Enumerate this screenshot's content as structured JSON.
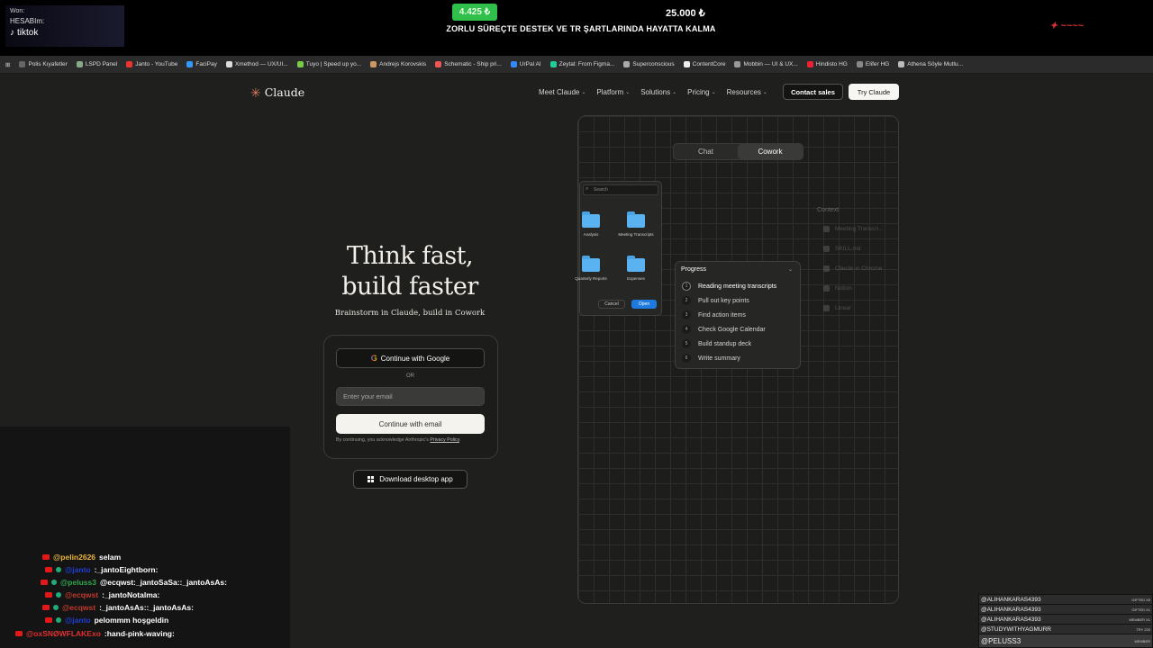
{
  "overlay": {
    "tiktok_line1": "Won:",
    "tiktok_line2": "HESABIm:",
    "tiktok_brand": "tiktok",
    "goal_current": "4.425 ₺",
    "goal_target": "25.000 ₺",
    "goal_title": "ZORLU SÜREÇTE DESTEK VE TR ŞARTLARINDA HAYATTA KALMA"
  },
  "bookmarks": [
    "Polis Kıyafetler",
    "LSPD Panel",
    "Janto - YouTube",
    "FaciPay",
    "Xmethod — UX/UI...",
    "Tuyo | Speed up yo...",
    "Andrejs Korovskis",
    "Schematic - Ship pri...",
    "UrPal AI",
    "Zeytal: From Figma...",
    "Superconscious",
    "ContentCore",
    "Mobbin — UI & UX...",
    "Hindisto HG",
    "Elifer HG",
    "Athena Söyle Mutlu..."
  ],
  "header": {
    "logo": "Claude",
    "nav": [
      "Meet Claude",
      "Platform",
      "Solutions",
      "Pricing",
      "Resources"
    ],
    "contact_sales": "Contact sales",
    "try_claude": "Try Claude"
  },
  "hero": {
    "title_line1": "Think fast,",
    "title_line2": "build faster",
    "subtitle": "Brainstorm in Claude, build in Cowork"
  },
  "signup": {
    "google_button": "Continue with Google",
    "or": "OR",
    "email_placeholder": "Enter your email",
    "continue_email": "Continue with email",
    "terms_prefix": "By continuing, you acknowledge Anthropic's",
    "privacy_link": "Privacy Policy",
    "download": "Download desktop app"
  },
  "demo": {
    "tab_chat": "Chat",
    "tab_cowork": "Cowork",
    "search_placeholder": "Search",
    "folders": [
      "Analysis",
      "Meeting Transcripts",
      "Quarterly Reports",
      "Expenses"
    ],
    "cancel": "Cancel",
    "open": "Open",
    "context_title": "Context",
    "context_items": [
      "Meeting Transcri...",
      "SKILL.md",
      "Claude in Chrome",
      "Notion",
      "Linear"
    ],
    "progress_title": "Progress",
    "steps": [
      {
        "num": "1",
        "label": "Reading meeting transcripts"
      },
      {
        "num": "2",
        "label": "Pull out key points"
      },
      {
        "num": "3",
        "label": "Find action items"
      },
      {
        "num": "4",
        "label": "Check Google Calendar"
      },
      {
        "num": "5",
        "label": "Build standup deck"
      },
      {
        "num": "6",
        "label": "Write summary"
      }
    ]
  },
  "chat": [
    {
      "user": "@pelin2626",
      "color": "#e8b53a",
      "message": "selam"
    },
    {
      "user": "@janto",
      "color": "#1f3fd6",
      "message": ":_jantoEightborn:"
    },
    {
      "user": "@peluss3",
      "color": "#2fa84f",
      "message": "@ecqwst:_jantoSaSa::_jantoAsAs:"
    },
    {
      "user": "@ecqwst",
      "color": "#c0392b",
      "message": ":_jantoNotalma:"
    },
    {
      "user": "@ecqwst",
      "color": "#c0392b",
      "message": ":_jantoAsAs::_jantoAsAs:"
    },
    {
      "user": "@janto",
      "color": "#1f3fd6",
      "message": "pelommm hoşgeldin"
    },
    {
      "user": "@oxSNØWFLAKExo",
      "color": "#e03030",
      "message": ":hand-pink-waving:"
    }
  ],
  "gifts": [
    {
      "name": "@ALIHANKARAS4393",
      "tag": "GIFTED X5"
    },
    {
      "name": "@ALIHANKARAS4393",
      "tag": "GIFTED X1"
    },
    {
      "name": "@ALIHANKARAS4393",
      "tag": "MEMBER X1"
    },
    {
      "name": "@STUDYWITHYAGMURR",
      "tag": "TRY 220"
    },
    {
      "name": "@PELUSS3",
      "tag": "MEMBER"
    }
  ]
}
